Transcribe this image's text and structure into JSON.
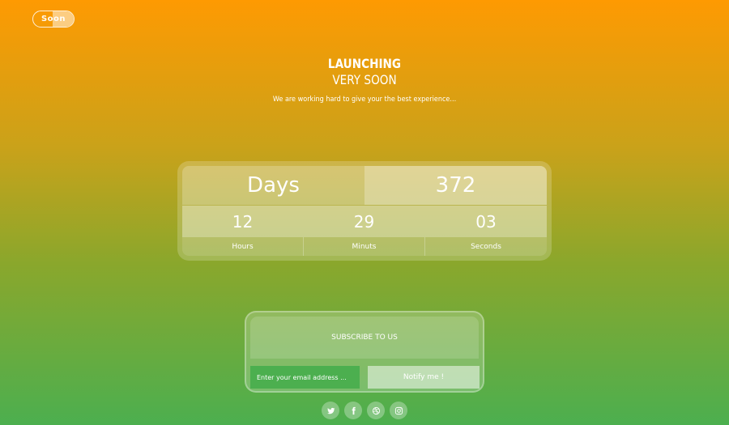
{
  "logo": {
    "text": "Soon"
  },
  "hero": {
    "title_line1": "LAUNCHING",
    "title_line2": "VERY SOON",
    "tagline": "We are working hard to give your the best experience..."
  },
  "countdown": {
    "days_label": "Days",
    "days_value": "372",
    "hours_value": "12",
    "hours_label": "Hours",
    "minutes_value": "29",
    "minutes_label": "Minuts",
    "seconds_value": "03",
    "seconds_label": "Seconds"
  },
  "subscribe": {
    "heading": "SUBSCRIBE TO US",
    "email_placeholder": "Enter your email address ...",
    "button_label": "Notify me !"
  },
  "social": [
    "twitter-icon",
    "facebook-icon",
    "dribbble-icon",
    "instagram-icon"
  ],
  "colors": {
    "top": "#fe9a02",
    "bottom": "#4caf4f",
    "input_bg": "#4caf4f"
  }
}
